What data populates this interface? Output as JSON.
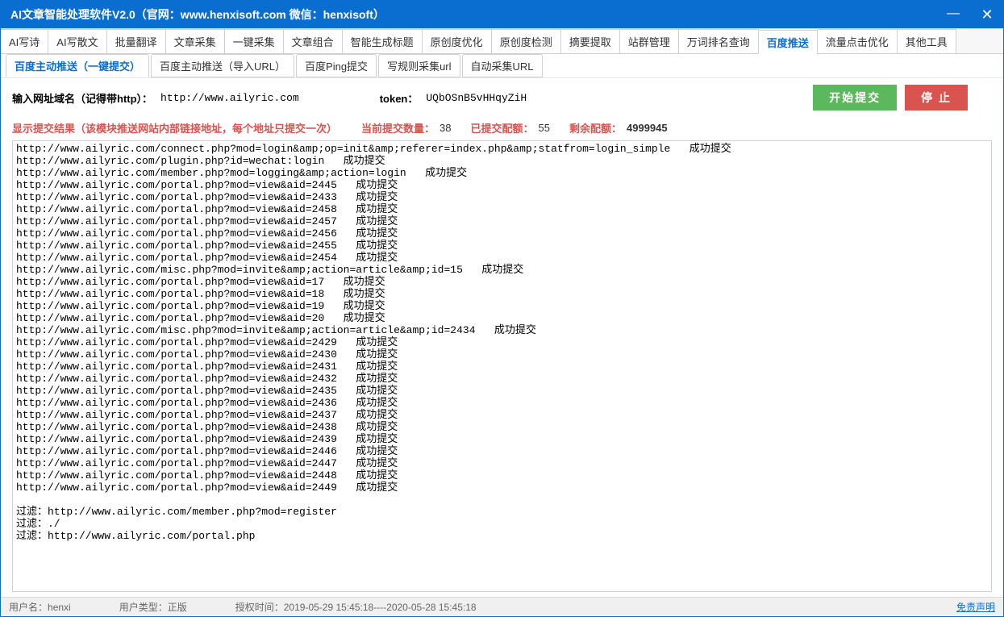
{
  "window": {
    "title": "AI文章智能处理软件V2.0（官网：www.henxisoft.com  微信：henxisoft）",
    "btn_min": "—",
    "btn_max": "□",
    "btn_close": "✕"
  },
  "main_tabs": [
    "AI写诗",
    "AI写散文",
    "批量翻译",
    "文章采集",
    "一键采集",
    "文章组合",
    "智能生成标题",
    "原创度优化",
    "原创度检测",
    "摘要提取",
    "站群管理",
    "万词排名查询",
    "百度推送",
    "流量点击优化",
    "其他工具"
  ],
  "main_tab_active_index": 12,
  "sub_tabs": [
    "百度主动推送（一键提交）",
    "百度主动推送（导入URL）",
    "百度Ping提交",
    "写规则采集url",
    "自动采集URL"
  ],
  "sub_tab_active_index": 0,
  "input_row": {
    "domain_label": "输入网址域名（记得带http）：",
    "domain_value": "http://www.ailyric.com",
    "token_label": "token：",
    "token_value": "UQbOSnB5vHHqyZiH",
    "btn_start": "开始提交",
    "btn_stop": "停 止"
  },
  "status_row": {
    "result_label": "显示提交结果（该模块推送网站内部链接地址，每个地址只提交一次）",
    "current_label": "当前提交数量：",
    "current_value": "38",
    "submitted_label": "已提交配额：",
    "submitted_value": "55",
    "remaining_label": "剩余配额：",
    "remaining_value": "4999945"
  },
  "results": [
    "http://www.ailyric.com/connect.php?mod=login&amp;op=init&amp;referer=index.php&amp;statfrom=login_simple   成功提交",
    "http://www.ailyric.com/plugin.php?id=wechat:login   成功提交",
    "http://www.ailyric.com/member.php?mod=logging&amp;action=login   成功提交",
    "http://www.ailyric.com/portal.php?mod=view&aid=2445   成功提交",
    "http://www.ailyric.com/portal.php?mod=view&aid=2433   成功提交",
    "http://www.ailyric.com/portal.php?mod=view&aid=2458   成功提交",
    "http://www.ailyric.com/portal.php?mod=view&aid=2457   成功提交",
    "http://www.ailyric.com/portal.php?mod=view&aid=2456   成功提交",
    "http://www.ailyric.com/portal.php?mod=view&aid=2455   成功提交",
    "http://www.ailyric.com/portal.php?mod=view&aid=2454   成功提交",
    "http://www.ailyric.com/misc.php?mod=invite&amp;action=article&amp;id=15   成功提交",
    "http://www.ailyric.com/portal.php?mod=view&aid=17   成功提交",
    "http://www.ailyric.com/portal.php?mod=view&aid=18   成功提交",
    "http://www.ailyric.com/portal.php?mod=view&aid=19   成功提交",
    "http://www.ailyric.com/portal.php?mod=view&aid=20   成功提交",
    "http://www.ailyric.com/misc.php?mod=invite&amp;action=article&amp;id=2434   成功提交",
    "http://www.ailyric.com/portal.php?mod=view&aid=2429   成功提交",
    "http://www.ailyric.com/portal.php?mod=view&aid=2430   成功提交",
    "http://www.ailyric.com/portal.php?mod=view&aid=2431   成功提交",
    "http://www.ailyric.com/portal.php?mod=view&aid=2432   成功提交",
    "http://www.ailyric.com/portal.php?mod=view&aid=2435   成功提交",
    "http://www.ailyric.com/portal.php?mod=view&aid=2436   成功提交",
    "http://www.ailyric.com/portal.php?mod=view&aid=2437   成功提交",
    "http://www.ailyric.com/portal.php?mod=view&aid=2438   成功提交",
    "http://www.ailyric.com/portal.php?mod=view&aid=2439   成功提交",
    "http://www.ailyric.com/portal.php?mod=view&aid=2446   成功提交",
    "http://www.ailyric.com/portal.php?mod=view&aid=2447   成功提交",
    "http://www.ailyric.com/portal.php?mod=view&aid=2448   成功提交",
    "http://www.ailyric.com/portal.php?mod=view&aid=2449   成功提交",
    "",
    "过滤：http://www.ailyric.com/member.php?mod=register",
    "过滤：./",
    "过滤：http://www.ailyric.com/portal.php"
  ],
  "footer": {
    "user_label": "用户名：",
    "user_value": "henxi",
    "type_label": "用户类型：",
    "type_value": "正版",
    "auth_label": "授权时间：",
    "auth_value": "2019-05-29 15:45:18----2020-05-28 15:45:18",
    "disclaimer": "免责声明"
  }
}
